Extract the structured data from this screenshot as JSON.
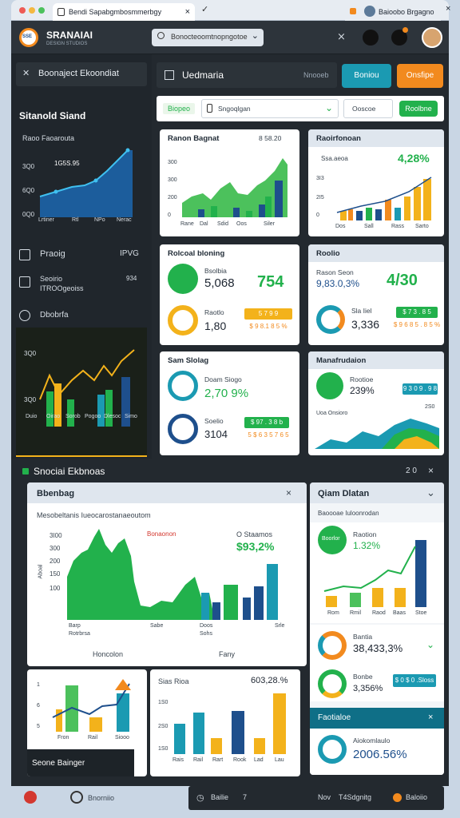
{
  "browser": {
    "tab_title": "Bendi Sapabgmbosmmerbgy",
    "tab2_title": "Baioobo Brgagno",
    "close_glyph": "×",
    "new_tab_glyph": "✓",
    "menu_glyph": "☰"
  },
  "app": {
    "logo_badge": "SSE",
    "brand_name": "SRANAIAI",
    "brand_tagline": "DESIGN STUDIOS",
    "search_placeholder": "Bonocteoomtnopngotoe",
    "search_caret": "⌄"
  },
  "sidebar": {
    "tools_title": "Boonaject Ekoondiat",
    "chart_title": "Sitanold Siand",
    "chart_sub": "Raoo Faoarouta",
    "chart_y": [
      "3Q0",
      "6Q0",
      "0Q0"
    ],
    "chart_value": "1G5S.95",
    "chart_x": [
      "Lrtiner",
      "Rtl",
      "NPo",
      "Nerac"
    ],
    "items": [
      {
        "label": "Praoig",
        "value": "IPVG"
      },
      {
        "label": "Seoirio",
        "sub": "ITROOgeoiss",
        "value": "934"
      },
      {
        "label": "Dbobrfa"
      }
    ],
    "bar_chart_y": [
      "3Q0",
      "3Q0"
    ],
    "bar_chart_x": [
      "Duio",
      "Oirao",
      "Sorob",
      "Pogoo",
      "Dlesoc",
      "Simo"
    ],
    "section_title": "Snociai Ekbnoas"
  },
  "main": {
    "tab_title": "Uedmaria",
    "tab_right": "Nnooeb",
    "btn_primary": "Boniou",
    "btn_orange": "Onsfipe",
    "filter_label": "Biopeo",
    "filter_select": "Sngoqlgan",
    "filter_btn": "Ooscoe",
    "filter_btn2": "Roolbne"
  },
  "cards": {
    "c1": {
      "title": "Ranon Bagnat",
      "meta": "8 58.20",
      "y_ticks": [
        "300",
        "300",
        "200",
        "0"
      ],
      "x": [
        "Rane",
        "Dal",
        "Sdid",
        "Oos",
        "Siler"
      ]
    },
    "c2": {
      "title": "Raoirfonoan",
      "meta": "Ssa.aeoa",
      "value": "4,28%",
      "y_ticks": [
        "3I3",
        "2I5",
        "0"
      ],
      "x": [
        "Dos",
        "Sall",
        "Rass",
        "Sarto"
      ]
    },
    "c3": {
      "title": "Rolcoal bloning",
      "row1_label": "Bsolbia",
      "row1_value": "5,068",
      "row1_big": "754",
      "row2_label": "Raotlo",
      "row2_value": "1,80",
      "row2_pill": "5 7 9 9",
      "row2_pill2": "$ 9 8.1 8 5 %"
    },
    "c4": {
      "title": "Roolio",
      "row1_label": "Rason Seon",
      "row1_value": "9,83.0,3%",
      "row1_big": "4/30",
      "row2_label": "Sla Iiel",
      "row2_value": "3,336",
      "row2_pill": "$ 7 3 . 8 5",
      "row2_sub": "$ 9 6 8 5 . 8 5 %"
    },
    "c5": {
      "title": "Sam Slolag",
      "row1_label": "Doam Siogo",
      "row1_value": "2,70 9%",
      "row2_label": "Soelio",
      "row2_value": "3104",
      "row2_pill": "$ 97 . 3 8 b",
      "row2_sub": "5 $ 6 3 5 7 6 5"
    },
    "c6": {
      "title": "Manafrudaion",
      "row1_label": "Rootioe",
      "row1_value": "239%",
      "row1_pill": "9 3 0 9 . 9 8",
      "area_label": "Uoa Onsioro",
      "area_tick": "2S0"
    }
  },
  "bottom": {
    "bar_title": "Snociai Ekbnoas",
    "bar_right": "2 0",
    "big_card": {
      "title": "Bbenbag",
      "sub": "Mesobeltanis Iueocarostanaeoutom",
      "y_ticks": [
        "3I00",
        "300",
        "200",
        "150",
        "100"
      ],
      "y_axis": "Aboal",
      "legend1": "Bonaonon",
      "legend2": "O Staamos",
      "value": "$93,2%",
      "x": [
        "Barp",
        "Sabe",
        "Doos",
        "Srle"
      ],
      "x_sub": "Rotrbrsa",
      "x_sub2": "Sohs",
      "foot_left": "Honcolon",
      "foot_right": "Fany"
    },
    "small1": {
      "label": "Seone Bainger",
      "y": [
        "1",
        "6",
        "5"
      ],
      "x": [
        "Fron",
        "Rail",
        "Siooo"
      ]
    },
    "small2": {
      "title": "Sias Rioa",
      "value": "603,28.%",
      "y": [
        "1S0",
        "2S0",
        "1S0"
      ],
      "x": [
        "Rais",
        "Rail",
        "Rart",
        "Rook",
        "Lad",
        "Lau"
      ]
    },
    "side": {
      "title": "Qiam Dlatan",
      "sub": "Baoooae Iuloonrodan",
      "donut1": "Boorlor",
      "row1_label": "Raotion",
      "row1_value": "1.32%",
      "x": [
        "Rom",
        "Rmil",
        "Raod",
        "Baas",
        "Stoe"
      ],
      "row2_label": "Bantia",
      "row2_value": "38,433,3%",
      "row3_label": "Bonbe",
      "row3_value": "3,356%",
      "row3_pill": "$ 0 $ 0 .Sloss",
      "row4_label": "Faotialoe",
      "row5_label": "Aiokomlaulo",
      "row5_value": "2006.56%"
    }
  },
  "status": {
    "left": "Bnorniio",
    "mid": "Bailie",
    "mid2": "7",
    "right": "Nov",
    "right2": "T4Sdgnitg",
    "right3": "Baloiio"
  },
  "colors": {
    "accent_teal": "#1b9ab2",
    "accent_orange": "#f28a1e",
    "green": "#22b14c",
    "navy": "#1e4f8c",
    "yellow": "#f3b21b",
    "dark_bg": "#23292f"
  }
}
